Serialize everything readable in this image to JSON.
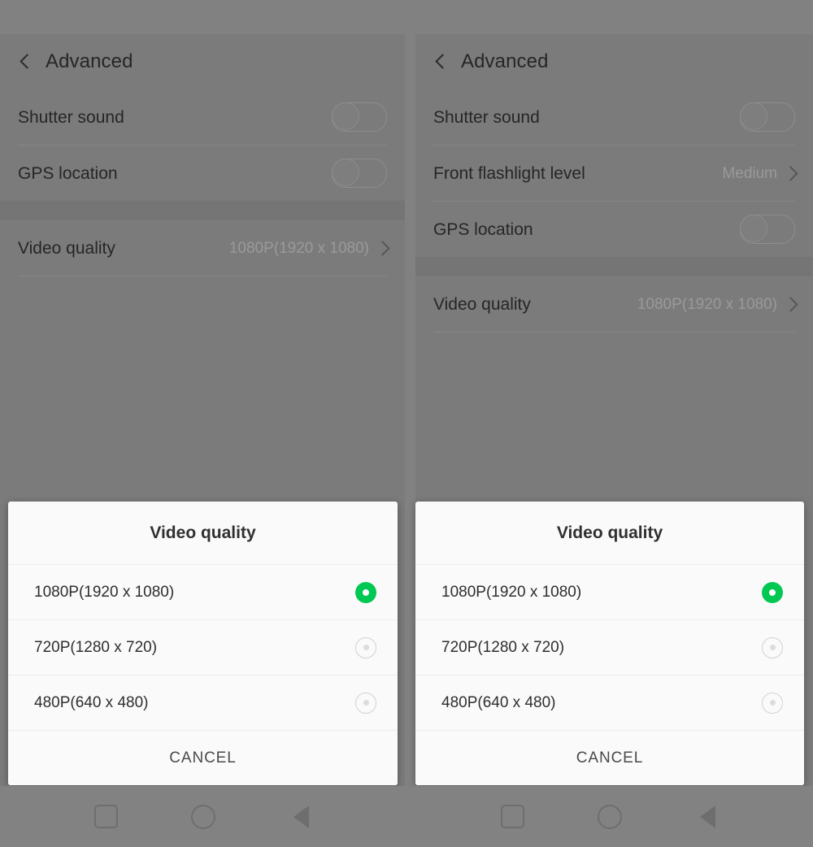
{
  "panels": [
    {
      "id": "left",
      "actionbar": {
        "back_icon": "back-chevron-icon",
        "title": "Advanced"
      },
      "rows": [
        {
          "label": "Shutter sound",
          "control": "toggle",
          "value": "",
          "state": "off"
        },
        {
          "label": "GPS location",
          "control": "toggle",
          "value": "",
          "state": "off"
        },
        {
          "label": "Video quality",
          "control": "chevron",
          "value": "1080P(1920 x 1080)",
          "state": ""
        }
      ]
    },
    {
      "id": "right",
      "actionbar": {
        "back_icon": "back-chevron-icon",
        "title": "Advanced"
      },
      "rows": [
        {
          "label": "Shutter sound",
          "control": "toggle",
          "value": "",
          "state": "off"
        },
        {
          "label": "Front flashlight level",
          "control": "chevron",
          "value": "Medium",
          "state": ""
        },
        {
          "label": "GPS location",
          "control": "toggle",
          "value": "",
          "state": "off"
        },
        {
          "label": "Video quality",
          "control": "chevron",
          "value": "1080P(1920 x 1080)",
          "state": ""
        }
      ]
    }
  ],
  "dialog": {
    "title": "Video quality",
    "options": [
      {
        "label": "1080P(1920 x 1080)",
        "selected": true
      },
      {
        "label": "720P(1280 x 720)",
        "selected": false
      },
      {
        "label": "480P(640 x 480)",
        "selected": false
      }
    ],
    "cancel_label": "CANCEL"
  },
  "navbar": {
    "buttons": [
      {
        "name": "recents-square-icon"
      },
      {
        "name": "home-circle-icon"
      },
      {
        "name": "back-triangle-icon"
      }
    ]
  },
  "colors": {
    "accent_green": "#00c853",
    "scrim_gray": "#818181",
    "dialog_bg": "#fafafa",
    "label_text": "#262626",
    "value_text": "#9a9a9a"
  }
}
